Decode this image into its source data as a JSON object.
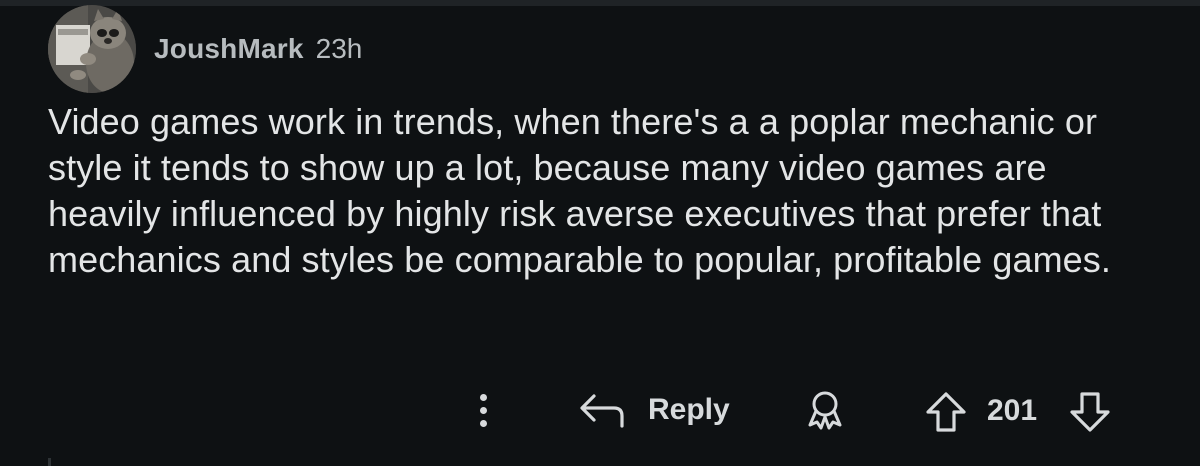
{
  "comment": {
    "author": "JoushMark",
    "timestamp": "23h",
    "body": "Video games work in trends, when there's a a poplar mechanic or style it tends to show up a lot, because many video games are heavily influenced by highly risk averse executives that prefer that mechanics and styles be comparable to popular, profitable games.",
    "avatar_icon": "raccoon-avatar",
    "actions": {
      "more_icon": "more-vertical-icon",
      "reply_label": "Reply",
      "reply_icon": "reply-arrow-icon",
      "award_icon": "award-icon",
      "upvote_icon": "upvote-arrow-icon",
      "score": "201",
      "downvote_icon": "downvote-arrow-icon"
    }
  },
  "colors": {
    "background": "#0e1113",
    "text": "#e3e5e6",
    "meta_text": "#b7bcbf",
    "icon": "#d7dadc"
  }
}
